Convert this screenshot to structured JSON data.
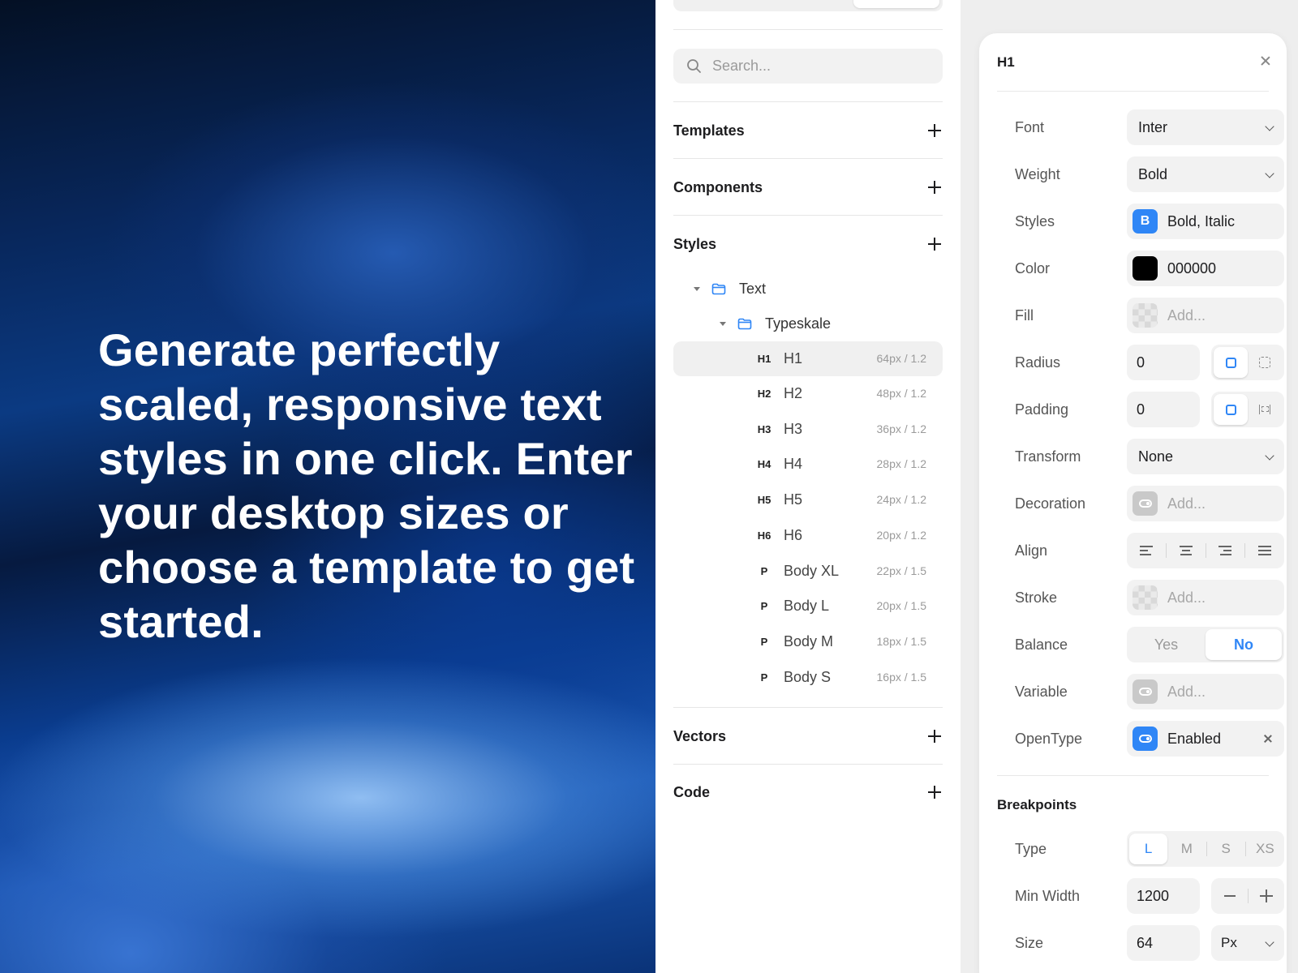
{
  "hero": {
    "headline": "Generate perfectly scaled, responsive text styles in one click. Enter your desktop sizes or choose a template to get started."
  },
  "sidebar": {
    "search_placeholder": "Search...",
    "sections": {
      "templates": "Templates",
      "components": "Components",
      "styles": "Styles",
      "vectors": "Vectors",
      "code": "Code"
    },
    "tree": {
      "folder1": "Text",
      "folder2": "Typeskale"
    },
    "styles": [
      {
        "tag": "H1",
        "name": "H1",
        "meta": "64px / 1.2"
      },
      {
        "tag": "H2",
        "name": "H2",
        "meta": "48px / 1.2"
      },
      {
        "tag": "H3",
        "name": "H3",
        "meta": "36px / 1.2"
      },
      {
        "tag": "H4",
        "name": "H4",
        "meta": "28px / 1.2"
      },
      {
        "tag": "H5",
        "name": "H5",
        "meta": "24px / 1.2"
      },
      {
        "tag": "H6",
        "name": "H6",
        "meta": "20px / 1.2"
      },
      {
        "tag": "P",
        "name": "Body XL",
        "meta": "22px / 1.5"
      },
      {
        "tag": "P",
        "name": "Body L",
        "meta": "20px / 1.5"
      },
      {
        "tag": "P",
        "name": "Body M",
        "meta": "18px / 1.5"
      },
      {
        "tag": "P",
        "name": "Body S",
        "meta": "16px / 1.5"
      }
    ]
  },
  "panel": {
    "title": "H1",
    "labels": {
      "font": "Font",
      "weight": "Weight",
      "styles": "Styles",
      "color": "Color",
      "fill": "Fill",
      "radius": "Radius",
      "padding": "Padding",
      "transform": "Transform",
      "decoration": "Decoration",
      "align": "Align",
      "stroke": "Stroke",
      "balance": "Balance",
      "variable": "Variable",
      "opentype": "OpenType"
    },
    "values": {
      "font": "Inter",
      "weight": "Bold",
      "styles": "Bold, Italic",
      "styles_glyph": "B",
      "color": "000000",
      "fill": "Add...",
      "radius": "0",
      "padding": "0",
      "transform": "None",
      "decoration": "Add...",
      "stroke": "Add...",
      "balance_yes": "Yes",
      "balance_no": "No",
      "variable": "Add...",
      "opentype": "Enabled"
    },
    "breakpoints": {
      "heading": "Breakpoints",
      "type_label": "Type",
      "types": [
        "L",
        "M",
        "S",
        "XS"
      ],
      "min_width_label": "Min Width",
      "min_width": "1200",
      "size_label": "Size",
      "size": "64",
      "unit": "Px"
    }
  },
  "colors": {
    "accent": "#2f86f6",
    "color_swatch": "#000000"
  }
}
